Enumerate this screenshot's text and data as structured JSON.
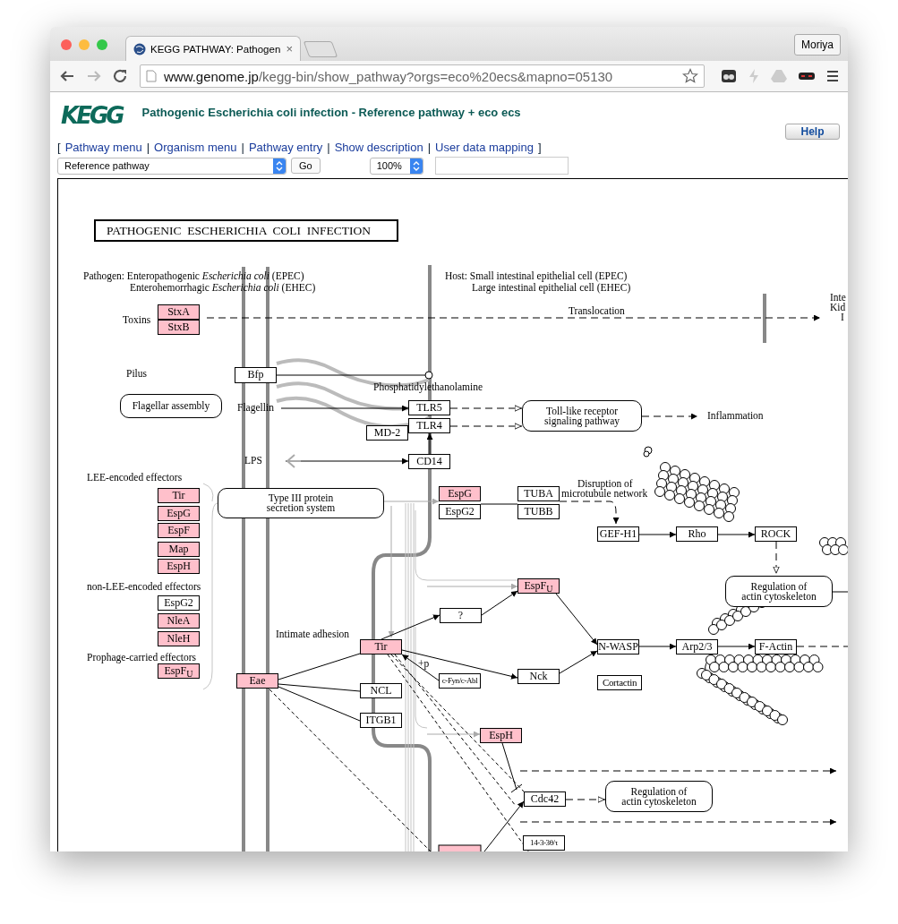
{
  "browser": {
    "tab": {
      "title": "KEGG PATHWAY: Pathogen",
      "close": "×"
    },
    "profile": "Moriya",
    "url_host": "www.genome.jp",
    "url_path": "/kegg-bin/show_pathway?orgs=eco%20ecs&mapno=05130"
  },
  "header": {
    "logo": "KEGG",
    "title": "Pathogenic Escherichia coli infection - Reference pathway + eco ecs",
    "help": "Help",
    "link_open": "[",
    "link_close": "]",
    "links": [
      "Pathway menu",
      "Organism menu",
      "Pathway entry",
      "Show description",
      "User data mapping"
    ],
    "separators": [
      "|",
      "|",
      "|",
      "|"
    ],
    "map_select": "Reference pathway",
    "go": "Go",
    "zoom_select": "100%"
  },
  "diagram": {
    "title": "PATHOGENIC  ESCHERICHIA  COLI  INFECTION",
    "elements": [
      {
        "kind": "note",
        "text": "Pathogen: Enteropathogenic *Escherichia coli* (EPEC)"
      },
      {
        "kind": "note",
        "text": "Enterohemorrhagic *Escherichia coli* (EHEC)"
      },
      {
        "kind": "note",
        "text": "Host: Small intestinal epithelial cell (EPEC)"
      },
      {
        "kind": "note",
        "text": "Large intestinal epithelial cell (EHEC)"
      },
      {
        "kind": "note",
        "text": "Toxins"
      },
      {
        "kind": "gene",
        "label": "StxA",
        "highlighted": true
      },
      {
        "kind": "gene",
        "label": "StxB",
        "highlighted": true
      },
      {
        "kind": "note",
        "text": "Translocation"
      },
      {
        "kind": "note",
        "text": "Inte"
      },
      {
        "kind": "note",
        "text": "Kid"
      },
      {
        "kind": "note",
        "text": "I"
      },
      {
        "kind": "note",
        "text": "Pilus"
      },
      {
        "kind": "gene",
        "label": "Bfp",
        "highlighted": false
      },
      {
        "kind": "note",
        "text": "Phosphatidylethanolamine"
      },
      {
        "kind": "pathway",
        "lines": [
          "Flagellar assembly"
        ]
      },
      {
        "kind": "note",
        "text": "Flagellin"
      },
      {
        "kind": "gene",
        "label": "TLR5",
        "highlighted": false
      },
      {
        "kind": "gene",
        "label": "TLR4",
        "highlighted": false
      },
      {
        "kind": "gene",
        "label": "MD-2",
        "highlighted": false
      },
      {
        "kind": "pathway",
        "lines": [
          "Toll-like receptor",
          "signaling pathway"
        ]
      },
      {
        "kind": "note",
        "text": "Inflammation"
      },
      {
        "kind": "note",
        "text": "LPS"
      },
      {
        "kind": "gene",
        "label": "CD14",
        "highlighted": false
      },
      {
        "kind": "note",
        "text": "LEE-encoded effectors"
      },
      {
        "kind": "gene",
        "label": "Tir",
        "highlighted": true
      },
      {
        "kind": "gene",
        "label": "EspG",
        "highlighted": true
      },
      {
        "kind": "gene",
        "label": "EspF",
        "highlighted": true
      },
      {
        "kind": "gene",
        "label": "Map",
        "highlighted": true
      },
      {
        "kind": "gene",
        "label": "EspH",
        "highlighted": true
      },
      {
        "kind": "note",
        "text": "non-LEE-encoded effectors"
      },
      {
        "kind": "gene",
        "label": "EspG2",
        "highlighted": false
      },
      {
        "kind": "gene",
        "label": "NleA",
        "highlighted": true
      },
      {
        "kind": "gene",
        "label": "NleH",
        "highlighted": true
      },
      {
        "kind": "note",
        "text": "Prophage-carried effectors"
      },
      {
        "kind": "gene",
        "label": "EspF$_{U}$",
        "highlighted": true
      },
      {
        "kind": "pathway",
        "lines": [
          "Type III protein",
          "secretion system"
        ]
      },
      {
        "kind": "gene",
        "label": "EspG",
        "highlighted": true
      },
      {
        "kind": "gene",
        "label": "EspG2",
        "highlighted": false
      },
      {
        "kind": "gene",
        "label": "TUBA",
        "highlighted": false
      },
      {
        "kind": "gene",
        "label": "TUBB",
        "highlighted": false
      },
      {
        "kind": "note",
        "text": "Disruption of"
      },
      {
        "kind": "note",
        "text": "microtubule network"
      },
      {
        "kind": "gene",
        "label": "GEF-H1",
        "highlighted": false
      },
      {
        "kind": "gene",
        "label": "Rho",
        "highlighted": false
      },
      {
        "kind": "gene",
        "label": "ROCK",
        "highlighted": false
      },
      {
        "kind": "gene",
        "label": "EspF$_{U}$",
        "highlighted": true
      },
      {
        "kind": "pathway",
        "lines": [
          "Regulation of",
          "actin cytoskeleton"
        ]
      },
      {
        "kind": "gene",
        "label": "?",
        "highlighted": false
      },
      {
        "kind": "note",
        "text": "Intimate adhesion"
      },
      {
        "kind": "gene",
        "label": "Tir",
        "highlighted": true
      },
      {
        "kind": "gene",
        "label": "N-WASP",
        "highlighted": false
      },
      {
        "kind": "gene",
        "label": "Arp2/3",
        "highlighted": false
      },
      {
        "kind": "gene",
        "label": "F-Actin",
        "highlighted": false
      },
      {
        "kind": "note",
        "text": "+p"
      },
      {
        "kind": "gene",
        "label": "Eae",
        "highlighted": true
      },
      {
        "kind": "gene",
        "label": "c-Fyn/c-Abl",
        "highlighted": false
      },
      {
        "kind": "gene",
        "label": "Nck",
        "highlighted": false
      },
      {
        "kind": "gene",
        "label": "Cortactin",
        "highlighted": false
      },
      {
        "kind": "gene",
        "label": "NCL",
        "highlighted": false
      },
      {
        "kind": "gene",
        "label": "ITGB1",
        "highlighted": false
      },
      {
        "kind": "gene",
        "label": "EspH",
        "highlighted": true
      },
      {
        "kind": "gene",
        "label": "Cdc42",
        "highlighted": false
      },
      {
        "kind": "pathway",
        "lines": [
          "Regulation of",
          "actin cytoskeleton"
        ]
      },
      {
        "kind": "gene",
        "label": "14-3-3θ/τ",
        "highlighted": false
      }
    ]
  }
}
